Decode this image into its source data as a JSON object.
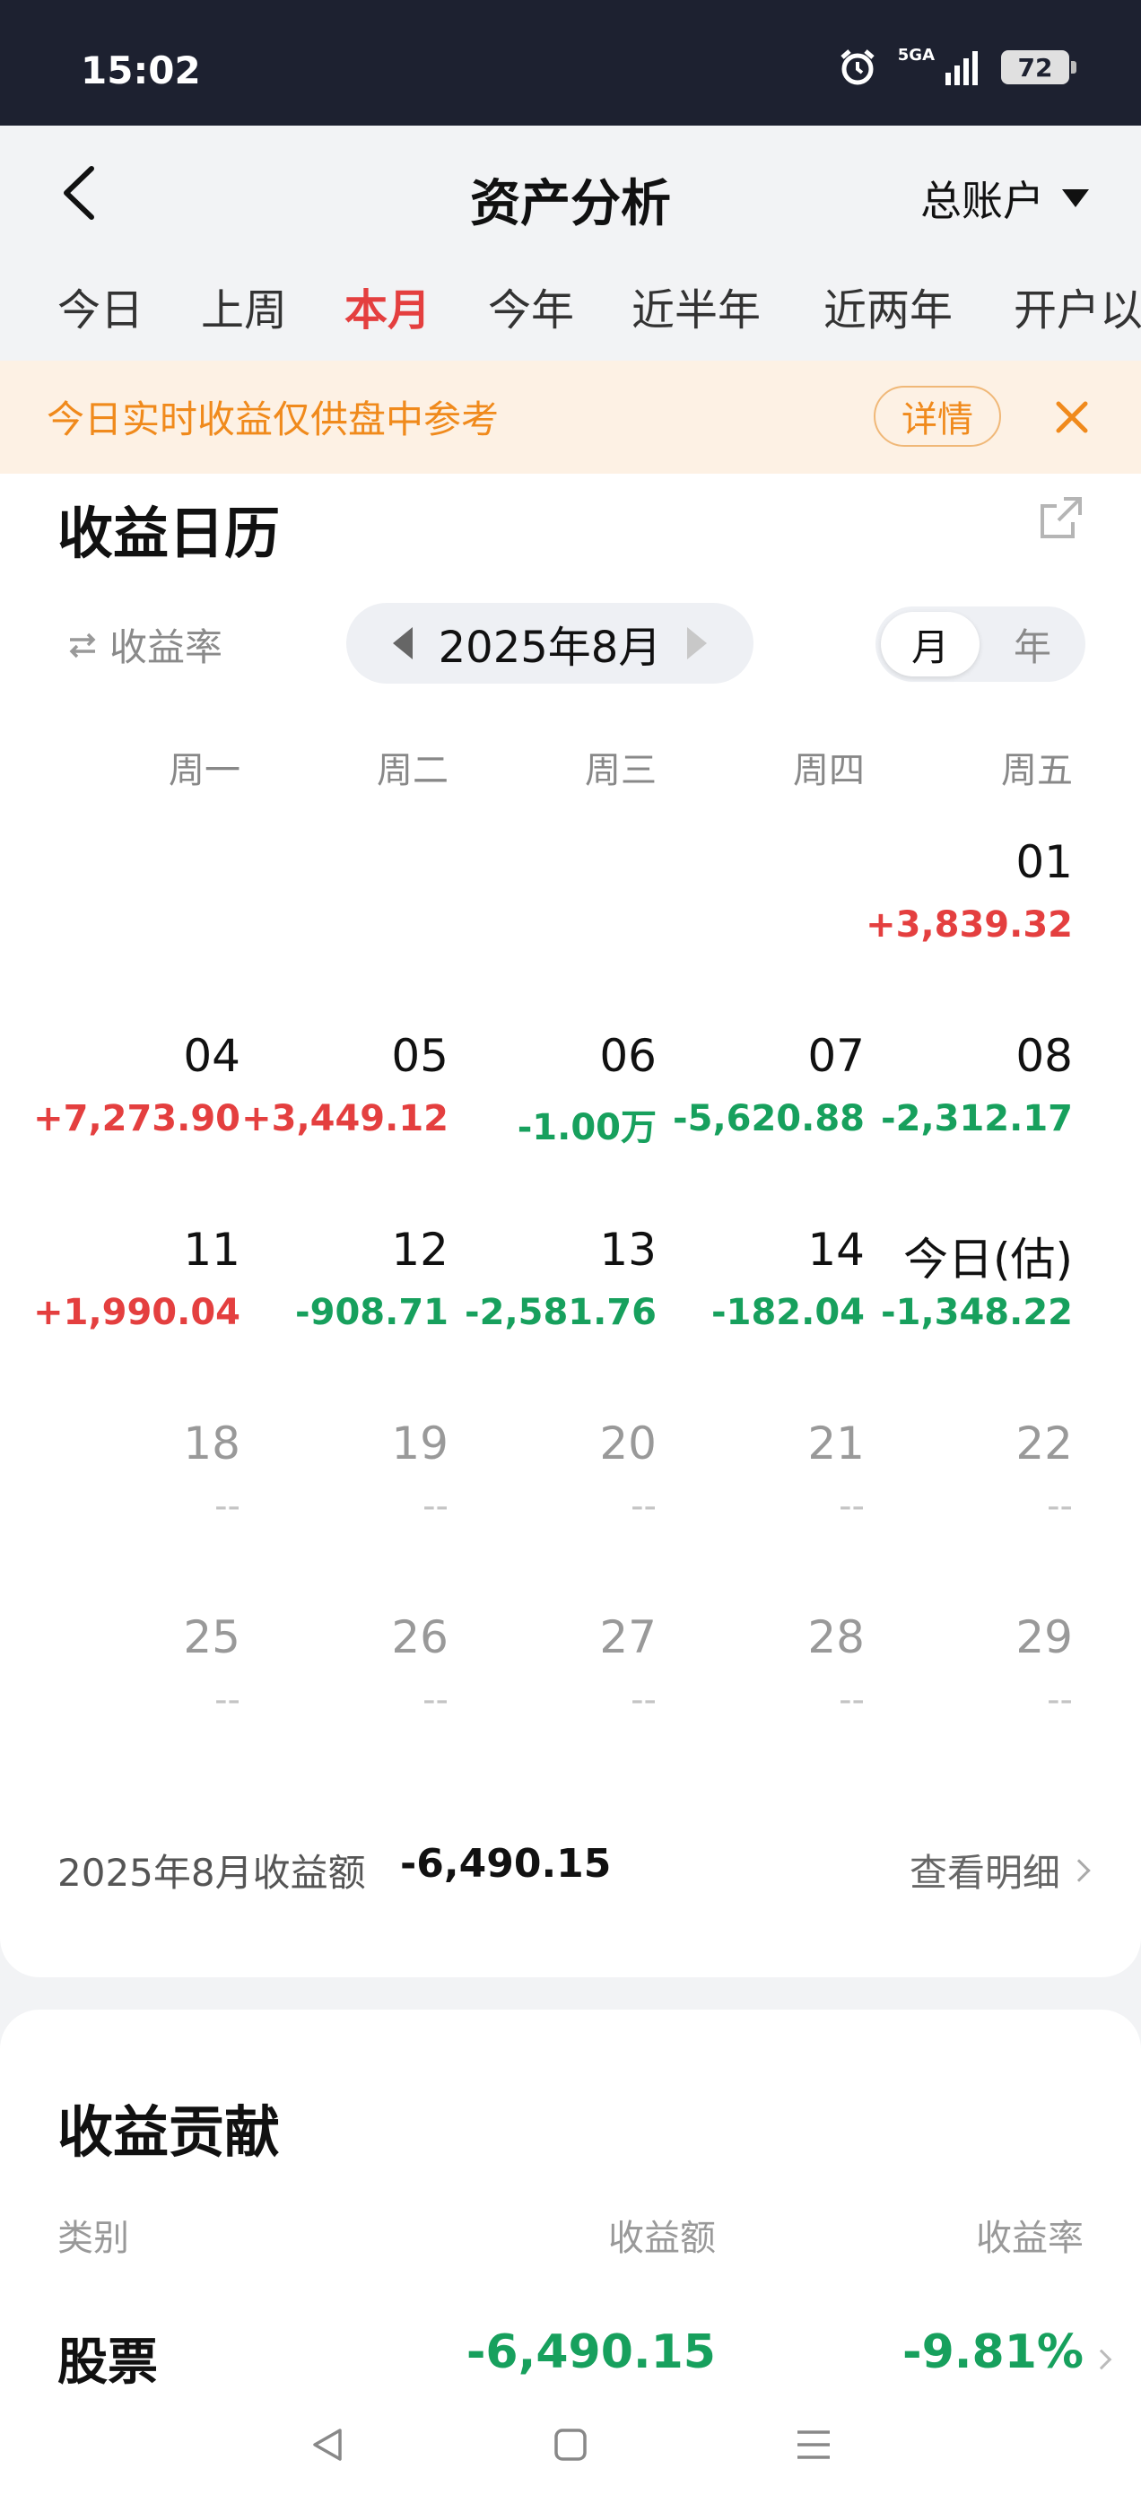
{
  "status_bar": {
    "time": "15:02",
    "network": "5GA",
    "battery": "72"
  },
  "header": {
    "title": "资产分析",
    "account": "总账户"
  },
  "period_tabs": [
    {
      "label": "今日",
      "active": false
    },
    {
      "label": "上周",
      "active": false
    },
    {
      "label": "本月",
      "active": true
    },
    {
      "label": "今年",
      "active": false
    },
    {
      "label": "近半年",
      "active": false
    },
    {
      "label": "近两年",
      "active": false
    },
    {
      "label": "开户以",
      "active": false
    }
  ],
  "notice": {
    "text": "今日实时收益仅供盘中参考",
    "detail_label": "详情"
  },
  "calendar": {
    "title": "收益日历",
    "rate_toggle_label": "收益率",
    "month_label": "2025年8月",
    "view_month": "月",
    "view_year": "年",
    "weekdays": [
      "周一",
      "周二",
      "周三",
      "周四",
      "周五"
    ],
    "weeks": [
      [
        {
          "day": "",
          "value": "",
          "sign": ""
        },
        {
          "day": "",
          "value": "",
          "sign": ""
        },
        {
          "day": "",
          "value": "",
          "sign": ""
        },
        {
          "day": "",
          "value": "",
          "sign": ""
        },
        {
          "day": "01",
          "value": "+3,839.32",
          "sign": "pos"
        }
      ],
      [
        {
          "day": "04",
          "value": "+7,273.90",
          "sign": "pos"
        },
        {
          "day": "05",
          "value": "+3,449.12",
          "sign": "pos"
        },
        {
          "day": "06",
          "value": "-1.00万",
          "sign": "neg"
        },
        {
          "day": "07",
          "value": "-5,620.88",
          "sign": "neg"
        },
        {
          "day": "08",
          "value": "-2,312.17",
          "sign": "neg"
        }
      ],
      [
        {
          "day": "11",
          "value": "+1,990.04",
          "sign": "pos"
        },
        {
          "day": "12",
          "value": "-908.71",
          "sign": "neg"
        },
        {
          "day": "13",
          "value": "-2,581.76",
          "sign": "neg"
        },
        {
          "day": "14",
          "value": "-182.04",
          "sign": "neg"
        },
        {
          "day": "今日(估)",
          "value": "-1,348.22",
          "sign": "neg"
        }
      ],
      [
        {
          "day": "18",
          "value": "--",
          "sign": "future"
        },
        {
          "day": "19",
          "value": "--",
          "sign": "future"
        },
        {
          "day": "20",
          "value": "--",
          "sign": "future"
        },
        {
          "day": "21",
          "value": "--",
          "sign": "future"
        },
        {
          "day": "22",
          "value": "--",
          "sign": "future"
        }
      ],
      [
        {
          "day": "25",
          "value": "--",
          "sign": "future"
        },
        {
          "day": "26",
          "value": "--",
          "sign": "future"
        },
        {
          "day": "27",
          "value": "--",
          "sign": "future"
        },
        {
          "day": "28",
          "value": "--",
          "sign": "future"
        },
        {
          "day": "29",
          "value": "--",
          "sign": "future"
        }
      ]
    ],
    "summary_label": "2025年8月收益额",
    "summary_value": "-6,490.15",
    "view_detail_label": "查看明细"
  },
  "contribution": {
    "title": "收益贡献",
    "col_category": "类别",
    "col_amount": "收益额",
    "col_rate": "收益率",
    "rows": [
      {
        "category": "股票",
        "amount": "-6,490.15",
        "rate": "-9.81%"
      }
    ]
  },
  "colors": {
    "positive": "#e43f3f",
    "negative": "#17a05d",
    "accent_orange": "#f08a1c",
    "status_bar_bg": "#1d2130"
  }
}
